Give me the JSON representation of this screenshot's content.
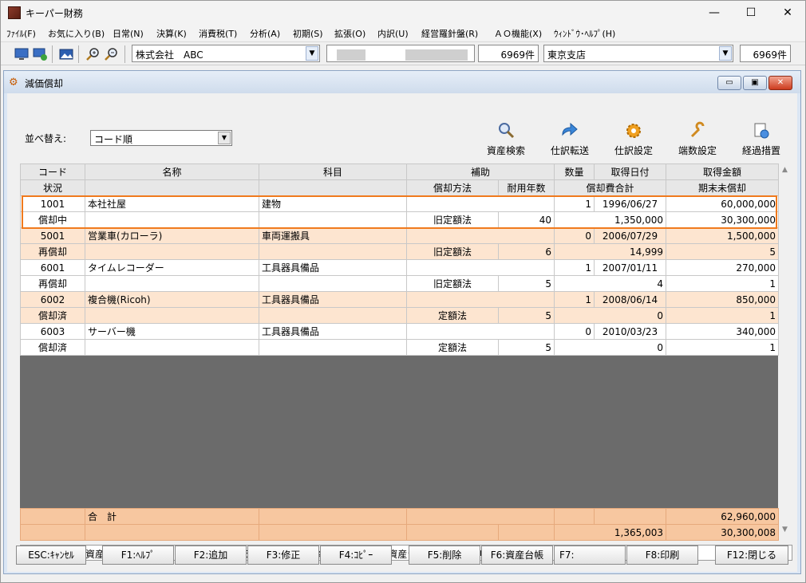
{
  "app": {
    "title": "キーパー財務"
  },
  "window_controls": {
    "minimize": "—",
    "maximize": "☐",
    "close": "✕"
  },
  "menu": [
    "ﾌｧｲﾙ(F)",
    "お気に入り(B)",
    "日常(N)",
    "決算(K)",
    "消費税(T)",
    "分析(A)",
    "初期(S)",
    "拡張(O)",
    "内訳(U)",
    "経営羅針盤(R)",
    "ＡＯ機能(X)",
    "ｳｨﾝﾄﾞｳ･ﾍﾙﾌﾟ(H)"
  ],
  "toolbar": {
    "company": "株式会社　ABC",
    "company_count": "6969件",
    "branch": "東京支店",
    "branch_count": "6969件"
  },
  "child_window": {
    "title": "減価償却",
    "controls": {
      "minimize": "▭",
      "restore": "▣",
      "close": "✕"
    }
  },
  "sort": {
    "label": "並べ替え:",
    "value": "コード順"
  },
  "actions": [
    {
      "label": "資産検索",
      "icon": "magnifier-icon"
    },
    {
      "label": "仕訳転送",
      "icon": "transfer-arrow-icon"
    },
    {
      "label": "仕訳設定",
      "icon": "gear-icon"
    },
    {
      "label": "端数設定",
      "icon": "wrench-icon"
    },
    {
      "label": "経過措置",
      "icon": "document-clock-icon"
    }
  ],
  "grid": {
    "header1": [
      "コード",
      "名称",
      "科目",
      "補助",
      "数量",
      "取得日付",
      "取得金額"
    ],
    "header2": [
      "状況",
      "",
      "",
      "償却方法",
      "耐用年数",
      "償却費合計",
      "期末未償却"
    ],
    "assets": [
      {
        "code": "1001",
        "name": "本社社屋",
        "account": "建物",
        "qty": "1",
        "date": "1996/06/27",
        "amount": "60,000,000",
        "status": "償却中",
        "method": "旧定額法",
        "years": "40",
        "dep_total": "1,350,000",
        "book_end": "30,300,000"
      },
      {
        "code": "5001",
        "name": "営業車(カローラ)",
        "account": "車両運搬具",
        "qty": "0",
        "date": "2006/07/29",
        "amount": "1,500,000",
        "status": "再償却",
        "method": "旧定額法",
        "years": "6",
        "dep_total": "14,999",
        "book_end": "5"
      },
      {
        "code": "6001",
        "name": "タイムレコーダー",
        "account": "工具器具備品",
        "qty": "1",
        "date": "2007/01/11",
        "amount": "270,000",
        "status": "再償却",
        "method": "旧定額法",
        "years": "5",
        "dep_total": "4",
        "book_end": "1"
      },
      {
        "code": "6002",
        "name": "複合機(Ricoh)",
        "account": "工具器具備品",
        "qty": "1",
        "date": "2008/06/14",
        "amount": "850,000",
        "status": "償却済",
        "method": "定額法",
        "years": "5",
        "dep_total": "0",
        "book_end": "1"
      },
      {
        "code": "6003",
        "name": "サーバー機",
        "account": "工具器具備品",
        "qty": "0",
        "date": "2010/03/23",
        "amount": "340,000",
        "status": "償却済",
        "method": "定額法",
        "years": "5",
        "dep_total": "0",
        "book_end": "1"
      }
    ],
    "totals": {
      "label": "合　計",
      "amount": "62,960,000",
      "dep_total": "1,365,003",
      "book_end": "30,300,008"
    }
  },
  "status_text": "[F2:追加]新規資産の登録 [F3:修正]資産の訂正、[F5:削除]資産の削除 [F6:資産台帳]資産台帳の参照・印刷",
  "fkeys": [
    "ESC:ｷｬﾝｾﾙ",
    "F1:ﾍﾙﾌﾟ",
    "F2:追加",
    "F3:修正",
    "F4:ｺﾋﾟｰ",
    "F5:削除",
    "F6:資産台帳",
    "F7:",
    "F8:印刷",
    "F12:閉じる"
  ]
}
